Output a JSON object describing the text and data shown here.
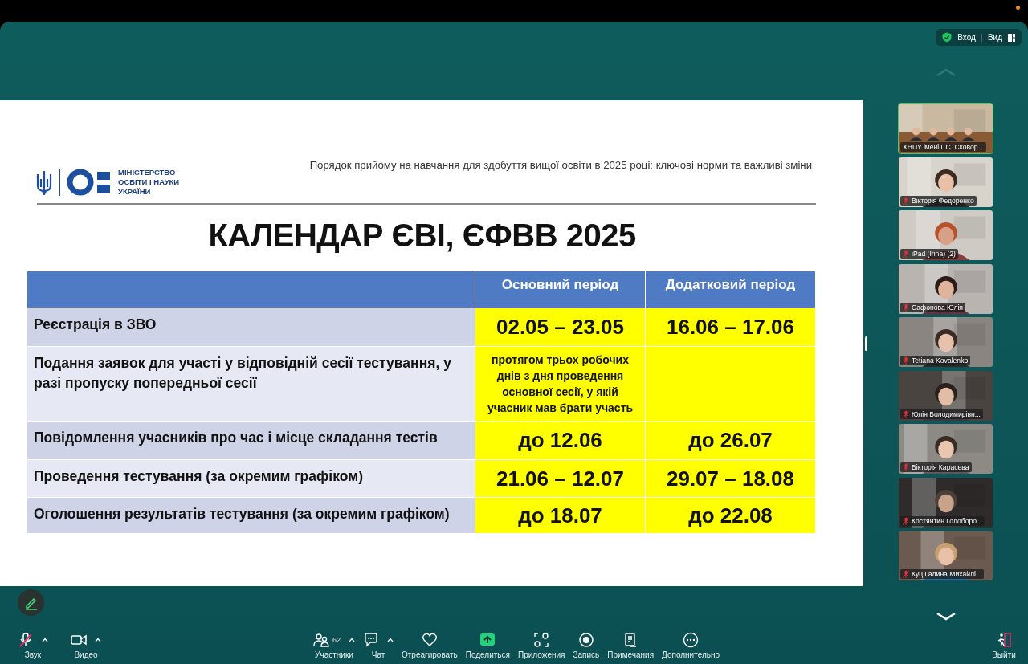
{
  "top_controls": {
    "security_label": "Вход",
    "view_label": "Вид"
  },
  "slide": {
    "subtitle": "Порядок прийому на навчання для здобуття вищої освіти в 2025 році: ключові норми та важливі зміни",
    "logo_lines": [
      "МІНІСТЕРСТВО",
      "ОСВІТИ І НАУКИ",
      "УКРАЇНИ"
    ],
    "title": "КАЛЕНДАР ЄВІ, ЄФВВ 2025",
    "table": {
      "columns": [
        "Основний період",
        "Додатковий період"
      ],
      "rows": [
        {
          "kind": "dates",
          "label": "Реєстрація в ЗВО",
          "main": "02.05 – 23.05",
          "extra": "16.06 – 17.06"
        },
        {
          "kind": "note",
          "label": "Подання заявок для участі у відповідній сесії тестування, у разі пропуску попередньої сесії",
          "main": "протягом трьох робочих днів з дня проведення основної сесії, у якій учасник мав брати участь"
        },
        {
          "kind": "dates",
          "label": "Повідомлення учасників про час і місце складання тестів",
          "main": "до 12.06",
          "extra": "до 26.07"
        },
        {
          "kind": "dates",
          "label": "Проведення тестування (за окремим графіком)",
          "main": "21.06 – 12.07",
          "extra": "29.07 – 18.08"
        },
        {
          "kind": "dates",
          "label": "Оголошення результатів тестування (за окремим графіком)",
          "main": "до 18.07",
          "extra": "до 22.08"
        }
      ]
    }
  },
  "participants": [
    {
      "name": "ХНПУ імені Г.С. Сковор...",
      "muted": false,
      "selected": true
    },
    {
      "name": "Вікторія Федоренко",
      "muted": true,
      "selected": false
    },
    {
      "name": "iPad (Irina) (2)",
      "muted": true,
      "selected": false
    },
    {
      "name": "Сафонова Юлія",
      "muted": true,
      "selected": false
    },
    {
      "name": "Tetiana Kovalenko",
      "muted": true,
      "selected": false
    },
    {
      "name": "Юлія Володимирівн...",
      "muted": true,
      "selected": false
    },
    {
      "name": "Вікторія Карасева",
      "muted": true,
      "selected": false
    },
    {
      "name": "Костянтин Голоборо...",
      "muted": true,
      "selected": false
    },
    {
      "name": "Куц Галина Михайлі...",
      "muted": true,
      "selected": false
    }
  ],
  "toolbar": {
    "left": [
      {
        "kind": "audio",
        "label": "Звук",
        "muted": true,
        "menu": true
      },
      {
        "kind": "video",
        "label": "Видео",
        "menu": true
      }
    ],
    "center": [
      {
        "kind": "participants",
        "label": "Участники",
        "count": "62",
        "menu": true
      },
      {
        "kind": "chat",
        "label": "Чат",
        "menu": true
      },
      {
        "kind": "react",
        "label": "Отреагировать",
        "menu": false
      },
      {
        "kind": "share",
        "label": "Поделиться",
        "menu": false
      },
      {
        "kind": "apps",
        "label": "Приложения",
        "menu": false
      },
      {
        "kind": "record",
        "label": "Запись",
        "menu": false
      },
      {
        "kind": "notes",
        "label": "Примечания",
        "menu": false
      },
      {
        "kind": "more",
        "label": "Дополнительно",
        "menu": false
      }
    ],
    "right": [
      {
        "kind": "leave",
        "label": "Выйти",
        "menu": false
      }
    ]
  }
}
